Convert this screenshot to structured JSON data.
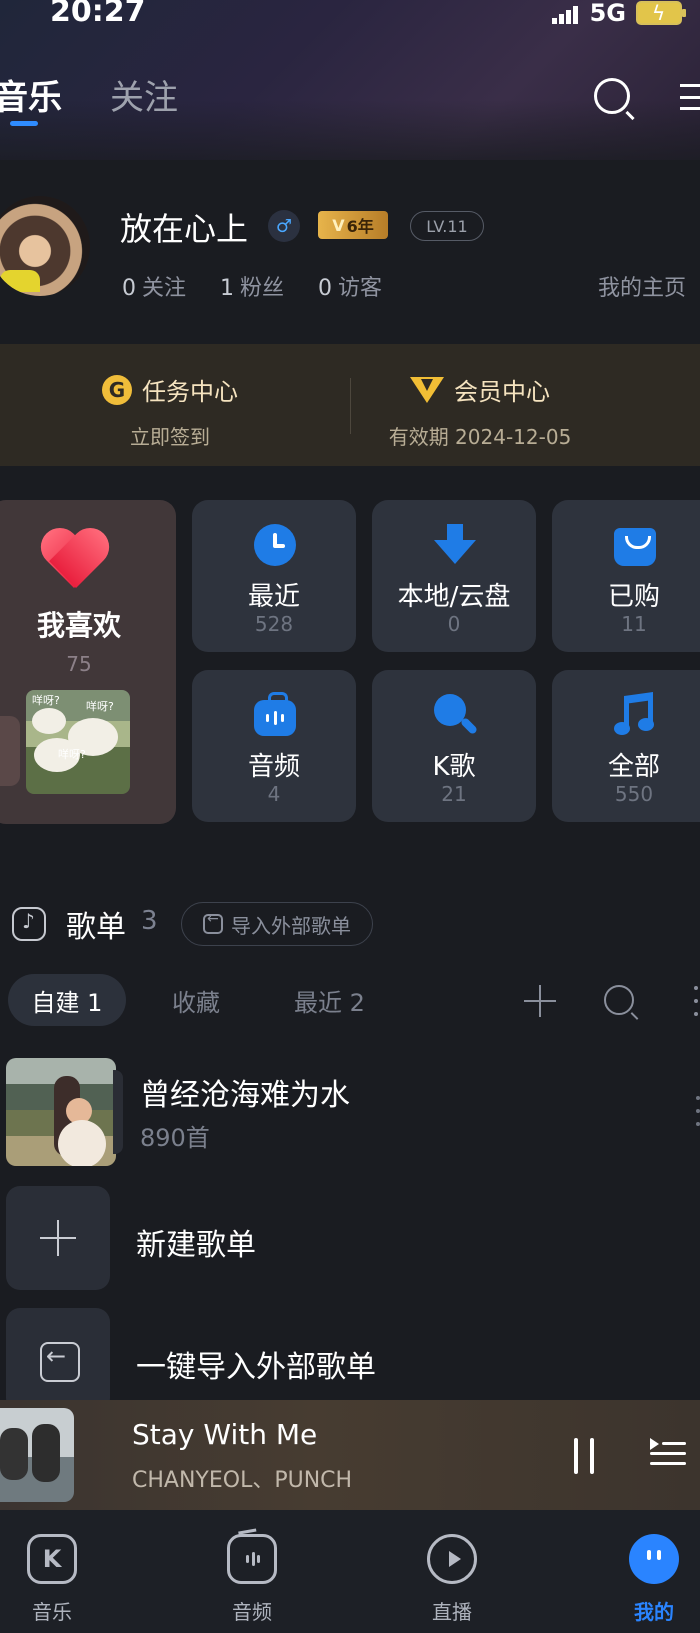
{
  "status": {
    "time": "20:27",
    "network": "5G"
  },
  "header": {
    "tabs": [
      {
        "label": "音乐",
        "active": true
      },
      {
        "label": "关注",
        "active": false
      }
    ],
    "icons": {
      "search": "search-icon",
      "menu": "menu-icon"
    }
  },
  "profile": {
    "name": "放在心上",
    "gender_symbol": "♂",
    "vip_years": "6年",
    "level": "LV.11",
    "stats": [
      {
        "value": "0",
        "label": "关注"
      },
      {
        "value": "1",
        "label": "粉丝"
      },
      {
        "value": "0",
        "label": "访客"
      }
    ],
    "home_link": "我的主页"
  },
  "center": {
    "task": {
      "icon_letter": "G",
      "title": "任务中心",
      "subtitle": "立即签到"
    },
    "vip": {
      "title": "会员中心",
      "subtitle": "有效期 2024-12-05"
    }
  },
  "library": {
    "favorite": {
      "label": "我喜欢",
      "count": "75",
      "image_captions": [
        "咩呀?",
        "咩呀?",
        "咩呀?"
      ]
    },
    "items": [
      {
        "label": "最近",
        "count": "528",
        "icon": "clock-icon"
      },
      {
        "label": "本地/云盘",
        "count": "0",
        "icon": "download-icon"
      },
      {
        "label": "已购",
        "count": "11",
        "icon": "bag-icon"
      },
      {
        "label": "音频",
        "count": "4",
        "icon": "audio-icon"
      },
      {
        "label": "K歌",
        "count": "21",
        "icon": "search-mic-icon"
      },
      {
        "label": "全部",
        "count": "550",
        "icon": "music-note-icon"
      }
    ]
  },
  "playlists": {
    "title": "歌单",
    "count": "3",
    "import_button": "导入外部歌单",
    "tabs": [
      {
        "label": "自建 1",
        "active": true
      },
      {
        "label": "收藏",
        "active": false
      },
      {
        "label": "最近 2",
        "active": false
      }
    ],
    "items": [
      {
        "name": "曾经沧海难为水",
        "count": "890首"
      }
    ],
    "actions": [
      {
        "label": "新建歌单",
        "icon": "plus-icon"
      },
      {
        "label": "一键导入外部歌单",
        "icon": "import-icon"
      }
    ]
  },
  "player": {
    "title": "Stay With Me",
    "artist": "CHANYEOL、PUNCH",
    "state": "playing"
  },
  "bottom_nav": [
    {
      "label": "音乐",
      "icon": "k-icon",
      "active": false
    },
    {
      "label": "音频",
      "icon": "audio-icon",
      "active": false
    },
    {
      "label": "直播",
      "icon": "play-icon",
      "active": false
    },
    {
      "label": "我的",
      "icon": "profile-icon",
      "active": true
    }
  ],
  "colors": {
    "background": "#1a1c21",
    "accent": "#2a84ff",
    "card": "#2e333d",
    "gold": "#f2be35",
    "player": "#473c31"
  }
}
